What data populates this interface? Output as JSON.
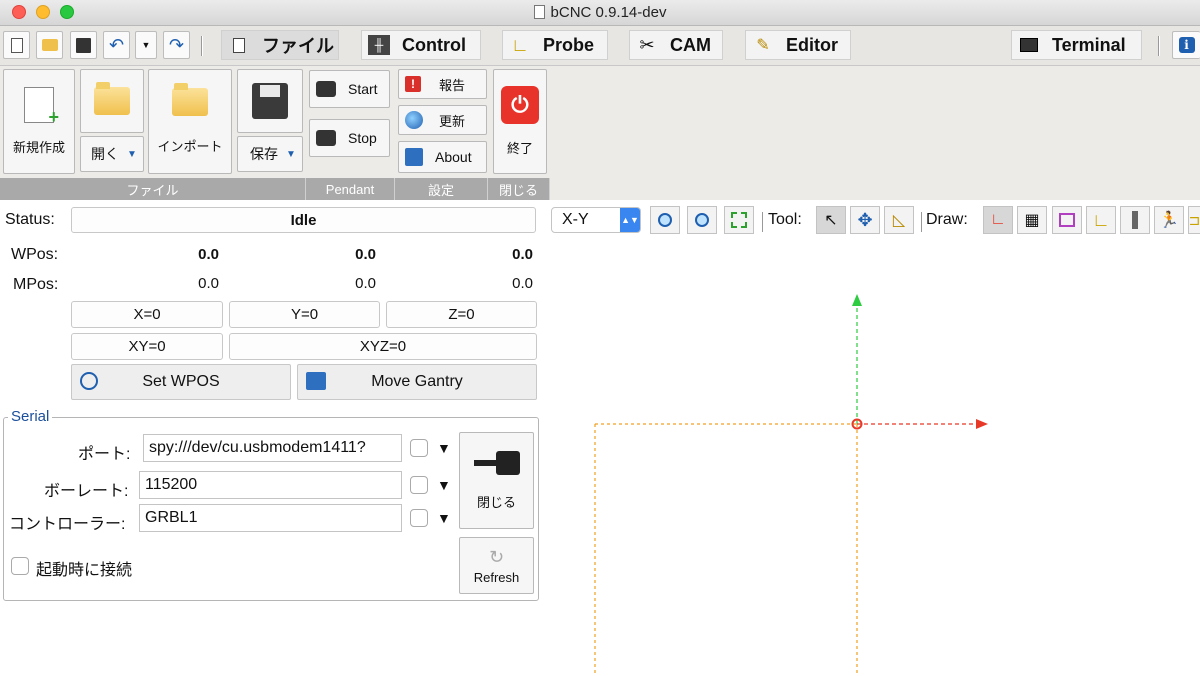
{
  "window": {
    "title": "bCNC 0.9.14-dev"
  },
  "tabs": [
    {
      "label": "ファイル",
      "icon": "document-icon"
    },
    {
      "label": "Control",
      "icon": "sliders-icon"
    },
    {
      "label": "Probe",
      "icon": "ruler-icon"
    },
    {
      "label": "CAM",
      "icon": "tools-icon"
    },
    {
      "label": "Editor",
      "icon": "pencil-icon"
    },
    {
      "label": "Terminal",
      "icon": "terminal-icon"
    }
  ],
  "ribbon": {
    "file": {
      "new": "新規作成",
      "open": "開く",
      "import": "インポート",
      "save": "保存",
      "group": "ファイル"
    },
    "pendant": {
      "start": "Start",
      "stop": "Stop",
      "group": "Pendant"
    },
    "settings": {
      "report": "報告",
      "update": "更新",
      "about": "About",
      "group": "設定"
    },
    "close": {
      "exit": "終了",
      "group": "閉じる"
    }
  },
  "status": {
    "label": "Status:",
    "value": "Idle"
  },
  "wpos": {
    "label": "WPos:",
    "x": "0.0",
    "y": "0.0",
    "z": "0.0"
  },
  "mpos": {
    "label": "MPos:",
    "x": "0.0",
    "y": "0.0",
    "z": "0.0"
  },
  "zero_buttons": {
    "x": "X=0",
    "y": "Y=0",
    "z": "Z=0",
    "xy": "XY=0",
    "xyz": "XYZ=0"
  },
  "actions": {
    "set_wpos": "Set WPOS",
    "move_gantry": "Move Gantry"
  },
  "serial": {
    "title": "Serial",
    "port_label": "ポート:",
    "port_value": "spy:///dev/cu.usbmodem1411?",
    "baud_label": "ボーレート:",
    "baud_value": "115200",
    "controller_label": "コントローラー:",
    "controller_value": "GRBL1",
    "autostart_label": "起動時に接続",
    "close_button": "閉じる",
    "refresh_button": "Refresh"
  },
  "canvas_toolbar": {
    "view": "X-Y",
    "tool_label": "Tool:",
    "draw_label": "Draw:"
  },
  "colors": {
    "axis_x": "#e83828",
    "axis_y": "#2ecc40",
    "margin": "#f0a020",
    "accent": "#1f5fb0"
  }
}
